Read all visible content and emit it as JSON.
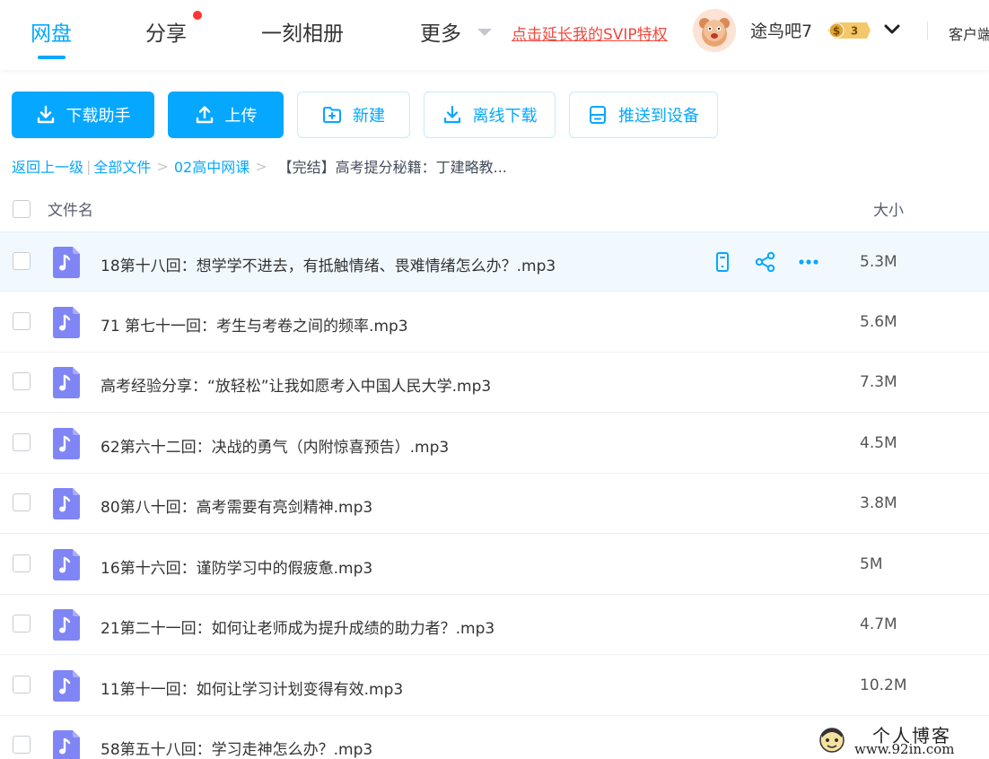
{
  "nav": {
    "tabs": [
      {
        "label": "网盘",
        "active": true
      },
      {
        "label": "分享",
        "active": false,
        "has_dot": true
      },
      {
        "label": "一刻相册",
        "active": false
      },
      {
        "label": "更多",
        "active": false
      }
    ],
    "svip_link": "点击延长我的SVIP特权",
    "username": "途鸟吧7",
    "level_badge": "3",
    "client_link": "客户端",
    "accent_color": "#06a7ff"
  },
  "toolbar": {
    "buttons": [
      {
        "label": "下载助手",
        "icon": "download-icon",
        "style": "primary"
      },
      {
        "label": "上传",
        "icon": "upload-icon",
        "style": "primary"
      },
      {
        "label": "新建",
        "icon": "new-folder-icon",
        "style": "outline"
      },
      {
        "label": "离线下载",
        "icon": "offline-download-icon",
        "style": "outline"
      },
      {
        "label": "推送到设备",
        "icon": "push-device-icon",
        "style": "outline"
      }
    ]
  },
  "breadcrumb": {
    "back": "返回上一级",
    "divider": "|",
    "items": [
      "全部文件",
      "02高中网课"
    ],
    "separator": ">",
    "current": "【完结】高考提分秘籍：丁建略教..."
  },
  "list": {
    "columns": {
      "name": "文件名",
      "size": "大小"
    },
    "rows": [
      {
        "name": "18第十八回：想学学不进去，有抵触情绪、畏难情绪怎么办？.mp3",
        "size": "5.3M",
        "hover": true
      },
      {
        "name": "71 第七十一回：考生与考卷之间的频率.mp3",
        "size": "5.6M"
      },
      {
        "name": "高考经验分享：“放轻松”让我如愿考入中国人民大学.mp3",
        "size": "7.3M"
      },
      {
        "name": "62第六十二回：决战的勇气（内附惊喜预告）.mp3",
        "size": "4.5M"
      },
      {
        "name": "80第八十回：高考需要有亮剑精神.mp3",
        "size": "3.8M"
      },
      {
        "name": "16第十六回：谨防学习中的假疲惫.mp3",
        "size": "5M"
      },
      {
        "name": "21第二十一回：如何让老师成为提升成绩的助力者？.mp3",
        "size": "4.7M"
      },
      {
        "name": "11第十一回：如何让学习计划变得有效.mp3",
        "size": "10.2M"
      },
      {
        "name": "58第五十八回：学习走神怎么办？.mp3",
        "size": ""
      }
    ],
    "row_actions": [
      "send-to-phone-icon",
      "share-icon",
      "more-icon"
    ]
  },
  "watermark": {
    "line1": "个人博客",
    "line2": "www.92in.com"
  }
}
